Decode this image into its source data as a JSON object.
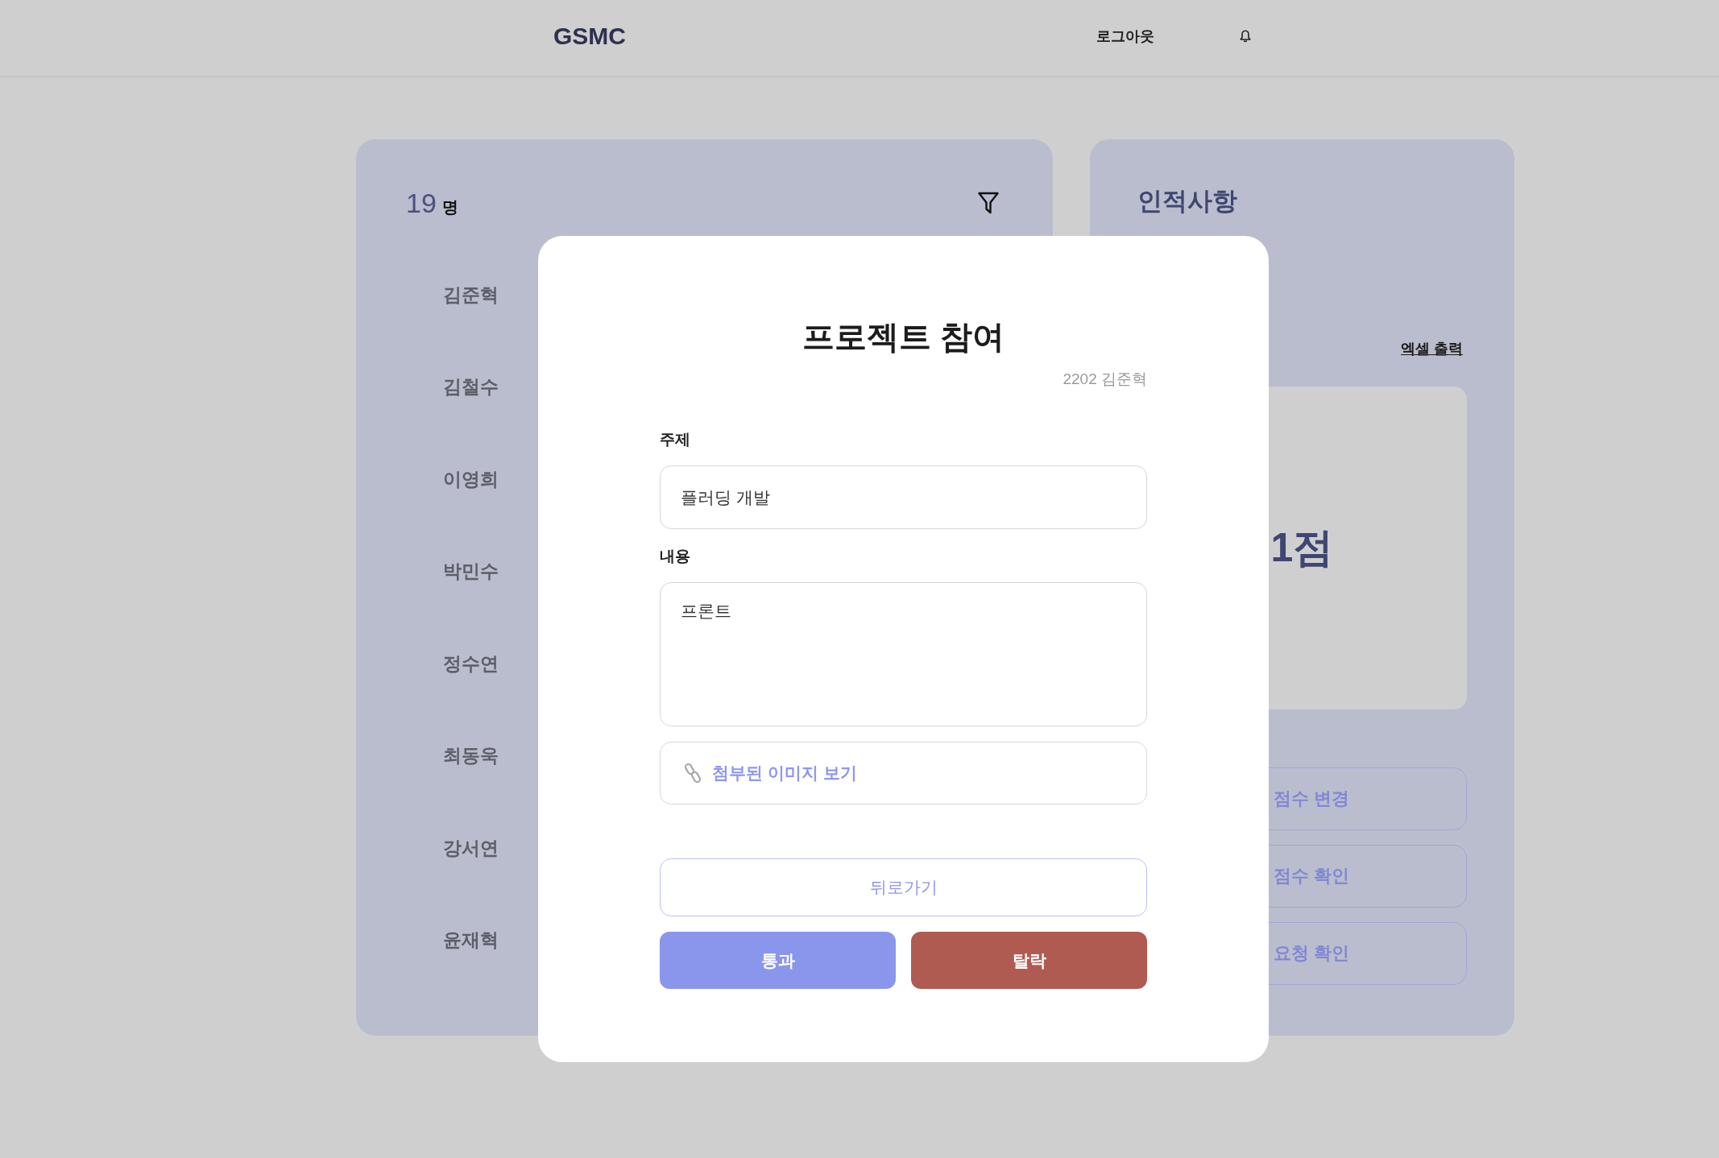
{
  "header": {
    "logo": "GSMC",
    "logout": "로그아웃"
  },
  "student_list": {
    "count": "19",
    "count_unit": "명",
    "students": [
      "김준혁",
      "김철수",
      "이영희",
      "박민수",
      "정수연",
      "최동욱",
      "강서연",
      "윤재혁"
    ]
  },
  "profile_panel": {
    "title": "인적사항",
    "export_link": "엑셀 출력",
    "score": "1점",
    "actions": [
      "점수 변경",
      "점수 확인",
      "요청 확인"
    ]
  },
  "modal": {
    "title": "프로젝트 참여",
    "subtitle": "2202 김준혁",
    "fields": [
      {
        "label": "주제",
        "kind": "input",
        "value": "플러딩 개발"
      },
      {
        "label": "내용",
        "kind": "textarea",
        "value": "프론트"
      }
    ],
    "attachment": "첨부된 이미지 보기",
    "back_button": "뒤로가기",
    "buttons": [
      {
        "label": "통과",
        "kind": "approve"
      },
      {
        "label": "탈락",
        "kind": "reject"
      }
    ]
  }
}
